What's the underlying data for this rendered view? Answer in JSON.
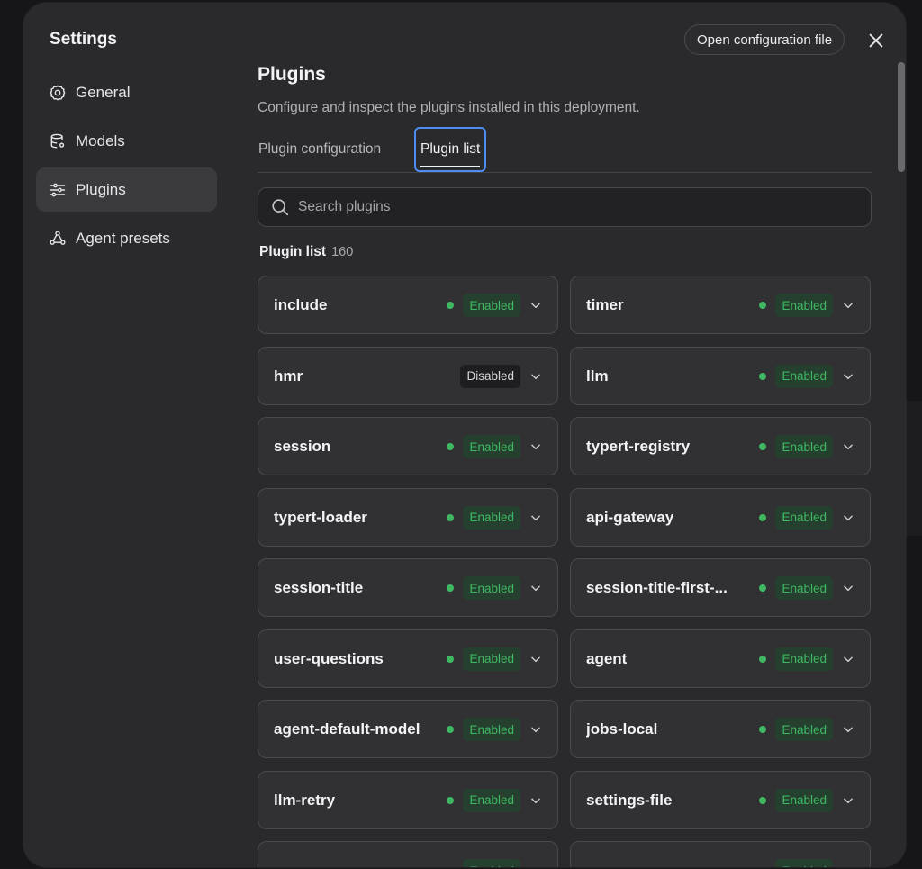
{
  "dialog": {
    "title": "Settings",
    "open_config_label": "Open configuration file"
  },
  "nav": [
    {
      "label": "General",
      "icon": "gear-icon"
    },
    {
      "label": "Models",
      "icon": "database-icon"
    },
    {
      "label": "Plugins",
      "icon": "sliders-icon",
      "active": true
    },
    {
      "label": "Agent presets",
      "icon": "agent-icon"
    }
  ],
  "page": {
    "title": "Plugins",
    "description": "Configure and inspect the plugins installed in this deployment.",
    "tabs": [
      {
        "label": "Plugin configuration"
      },
      {
        "label": "Plugin list",
        "active": true
      }
    ],
    "search_placeholder": "Search plugins",
    "list_title": "Plugin list",
    "list_count": "160"
  },
  "colors": {
    "enabled_green": "#3fb862",
    "focus_blue": "#4d8df0",
    "modal_bg": "#2a2a2c"
  },
  "plugins": [
    {
      "name": "include",
      "status": "Enabled"
    },
    {
      "name": "timer",
      "status": "Enabled"
    },
    {
      "name": "hmr",
      "status": "Disabled"
    },
    {
      "name": "llm",
      "status": "Enabled"
    },
    {
      "name": "session",
      "status": "Enabled"
    },
    {
      "name": "typert-registry",
      "status": "Enabled"
    },
    {
      "name": "typert-loader",
      "status": "Enabled"
    },
    {
      "name": "api-gateway",
      "status": "Enabled"
    },
    {
      "name": "session-title",
      "status": "Enabled"
    },
    {
      "name": "session-title-first-...",
      "status": "Enabled"
    },
    {
      "name": "user-questions",
      "status": "Enabled"
    },
    {
      "name": "agent",
      "status": "Enabled"
    },
    {
      "name": "agent-default-model",
      "status": "Enabled"
    },
    {
      "name": "jobs-local",
      "status": "Enabled"
    },
    {
      "name": "llm-retry",
      "status": "Enabled"
    },
    {
      "name": "settings-file",
      "status": "Enabled"
    },
    {
      "name": "",
      "status": "Enabled"
    },
    {
      "name": "",
      "status": "Enabled"
    }
  ]
}
